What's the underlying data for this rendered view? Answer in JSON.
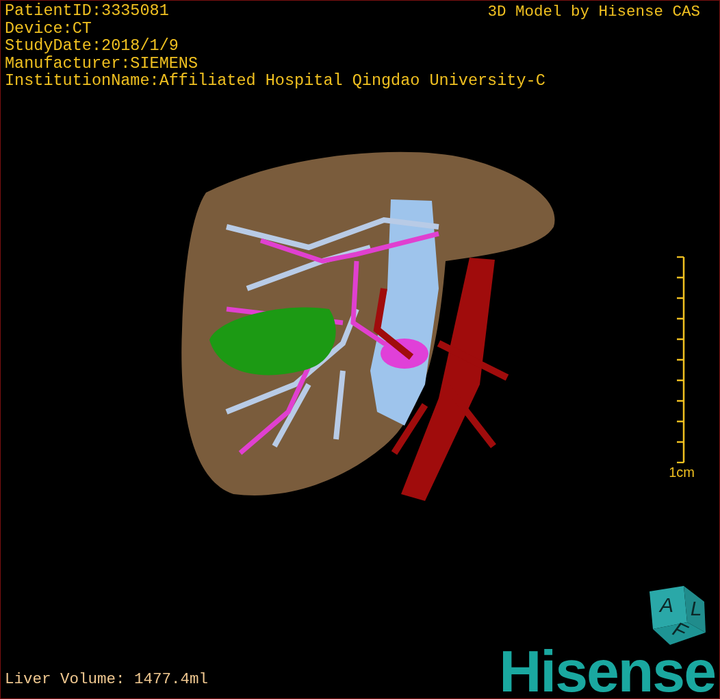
{
  "info_lines": [
    "PatientID:3335081",
    "Device:CT",
    "StudyDate:2018/1/9",
    "Manufacturer:SIEMENS",
    "InstitutionName:Affiliated Hospital Qingdao University-C"
  ],
  "model_credit": "3D Model by Hisense CAS",
  "scale_bar": {
    "label": "1cm"
  },
  "orientation_cube": {
    "labels": [
      "A",
      "L",
      "F"
    ]
  },
  "liver_volume": "Liver Volume: 1477.4ml",
  "logo": "Hisense"
}
